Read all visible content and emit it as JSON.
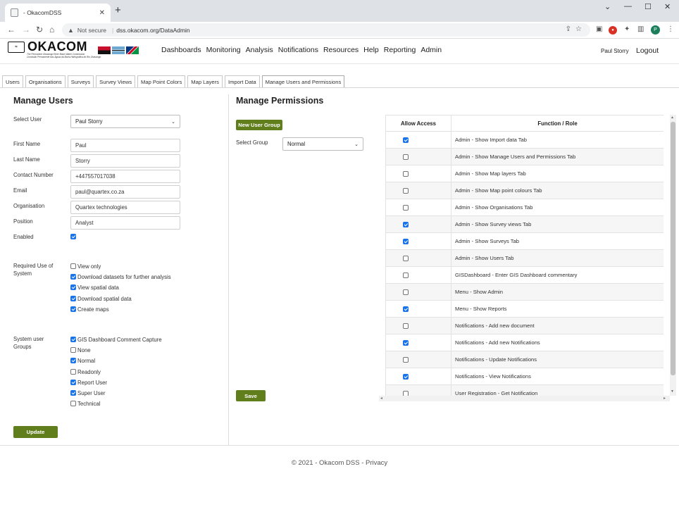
{
  "browser": {
    "tab_title": "- OkacomDSS",
    "not_secure": "Not secure",
    "url": "dss.okacom.org/DataAdmin",
    "profile_initial": "P"
  },
  "header": {
    "logo_text": "OKACOM",
    "logo_tagline_1": "The Permanent Okavango River Basin Water Commission",
    "logo_tagline_2": "Comissão Permanente das Águas da Bacia Hidrográfica do Rio Okavango",
    "nav": [
      "Dashboards",
      "Monitoring",
      "Analysis",
      "Notifications",
      "Resources",
      "Help",
      "Reporting",
      "Admin"
    ],
    "user_name": "Paul Storry",
    "logout": "Logout"
  },
  "admin_tabs": [
    "Users",
    "Organisations",
    "Surveys",
    "Survey Views",
    "Map Point Colors",
    "Map Layers",
    "Import Data",
    "Manage Users and Permissions"
  ],
  "manage_users": {
    "title": "Manage Users",
    "select_user_label": "Select User",
    "select_user_value": "Paul Storry",
    "fields": {
      "first_name_label": "First Name",
      "first_name": "Paul",
      "last_name_label": "Last Name",
      "last_name": "Storry",
      "contact_label": "Contact Number",
      "contact": "+447557017038",
      "email_label": "Email",
      "email": "paul@quartex.co.za",
      "org_label": "Organisation",
      "org": "Quartex technologies",
      "position_label": "Position",
      "position": "Analyst",
      "enabled_label": "Enabled"
    },
    "required_use_label_1": "Required Use of",
    "required_use_label_2": "System",
    "required_use": [
      {
        "label": "View only",
        "checked": false
      },
      {
        "label": "Download datasets for further analysis",
        "checked": true
      },
      {
        "label": "View spatial data",
        "checked": true
      },
      {
        "label": "Download spatial data",
        "checked": true
      },
      {
        "label": "Create maps",
        "checked": true
      }
    ],
    "groups_label_1": "System user",
    "groups_label_2": "Groups",
    "groups": [
      {
        "label": "GIS Dashboard Comment Capture",
        "checked": true
      },
      {
        "label": "None",
        "checked": false
      },
      {
        "label": "Normal",
        "checked": true
      },
      {
        "label": "Readonly",
        "checked": false
      },
      {
        "label": "Report User",
        "checked": true
      },
      {
        "label": "Super User",
        "checked": true
      },
      {
        "label": "Technical",
        "checked": false
      }
    ],
    "update_button": "Update"
  },
  "manage_permissions": {
    "title": "Manage Permissions",
    "new_group_button": "New User Group",
    "select_group_label": "Select Group",
    "select_group_value": "Normal",
    "save_button": "Save",
    "columns": [
      "Allow Access",
      "Function / Role"
    ],
    "rows": [
      {
        "role": "Admin - Show Import data Tab",
        "allowed": true
      },
      {
        "role": "Admin - Show Manage Users and Permissions Tab",
        "allowed": false
      },
      {
        "role": "Admin - Show Map layers Tab",
        "allowed": false
      },
      {
        "role": "Admin - Show Map point colours Tab",
        "allowed": false
      },
      {
        "role": "Admin - Show Organisations Tab",
        "allowed": false
      },
      {
        "role": "Admin - Show Survey views Tab",
        "allowed": true
      },
      {
        "role": "Admin - Show Surveys Tab",
        "allowed": true
      },
      {
        "role": "Admin - Show Users Tab",
        "allowed": false
      },
      {
        "role": "GISDashboard - Enter GIS Dashboard commentary",
        "allowed": false
      },
      {
        "role": "Menu - Show Admin",
        "allowed": false
      },
      {
        "role": "Menu - Show Reports",
        "allowed": true
      },
      {
        "role": "Notifications - Add new document",
        "allowed": false
      },
      {
        "role": "Notifications - Add new Notifications",
        "allowed": true
      },
      {
        "role": "Notifications - Update Notifications",
        "allowed": false
      },
      {
        "role": "Notifications - View Notifications",
        "allowed": true
      },
      {
        "role": "User Registration - Get Notification",
        "allowed": false
      }
    ]
  },
  "footer": {
    "copyright": "© 2021 - Okacom DSS - ",
    "privacy": "Privacy"
  }
}
